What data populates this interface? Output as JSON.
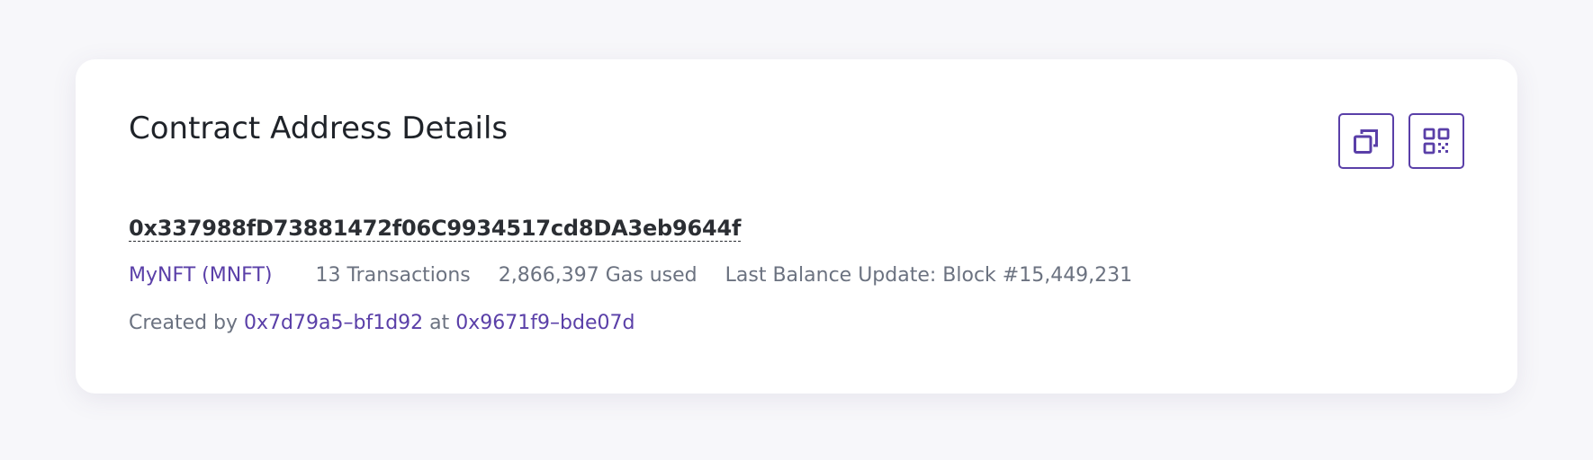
{
  "card": {
    "title": "Contract Address Details",
    "address": "0x337988fD73881472f06C9934517cd8DA3eb9644f",
    "token": "MyNFT (MNFT)",
    "transactions": "13 Transactions",
    "gas_used": "2,866,397 Gas used",
    "last_balance_update": "Last Balance Update: Block #15,449,231",
    "created_by_prefix": "Created by",
    "creator": "0x7d79a5–bf1d92",
    "at_word": "at",
    "creation_tx": "0x9671f9–bde07d",
    "buttons": [
      {
        "name": "copy-button",
        "icon": "copy-icon"
      },
      {
        "name": "qr-code-button",
        "icon": "qr-code-icon"
      }
    ]
  },
  "colors": {
    "accent": "#5a3fa8",
    "muted_text": "#6b7280",
    "heading_text": "#1f2329",
    "background": "#f7f7fa",
    "card": "#ffffff"
  }
}
